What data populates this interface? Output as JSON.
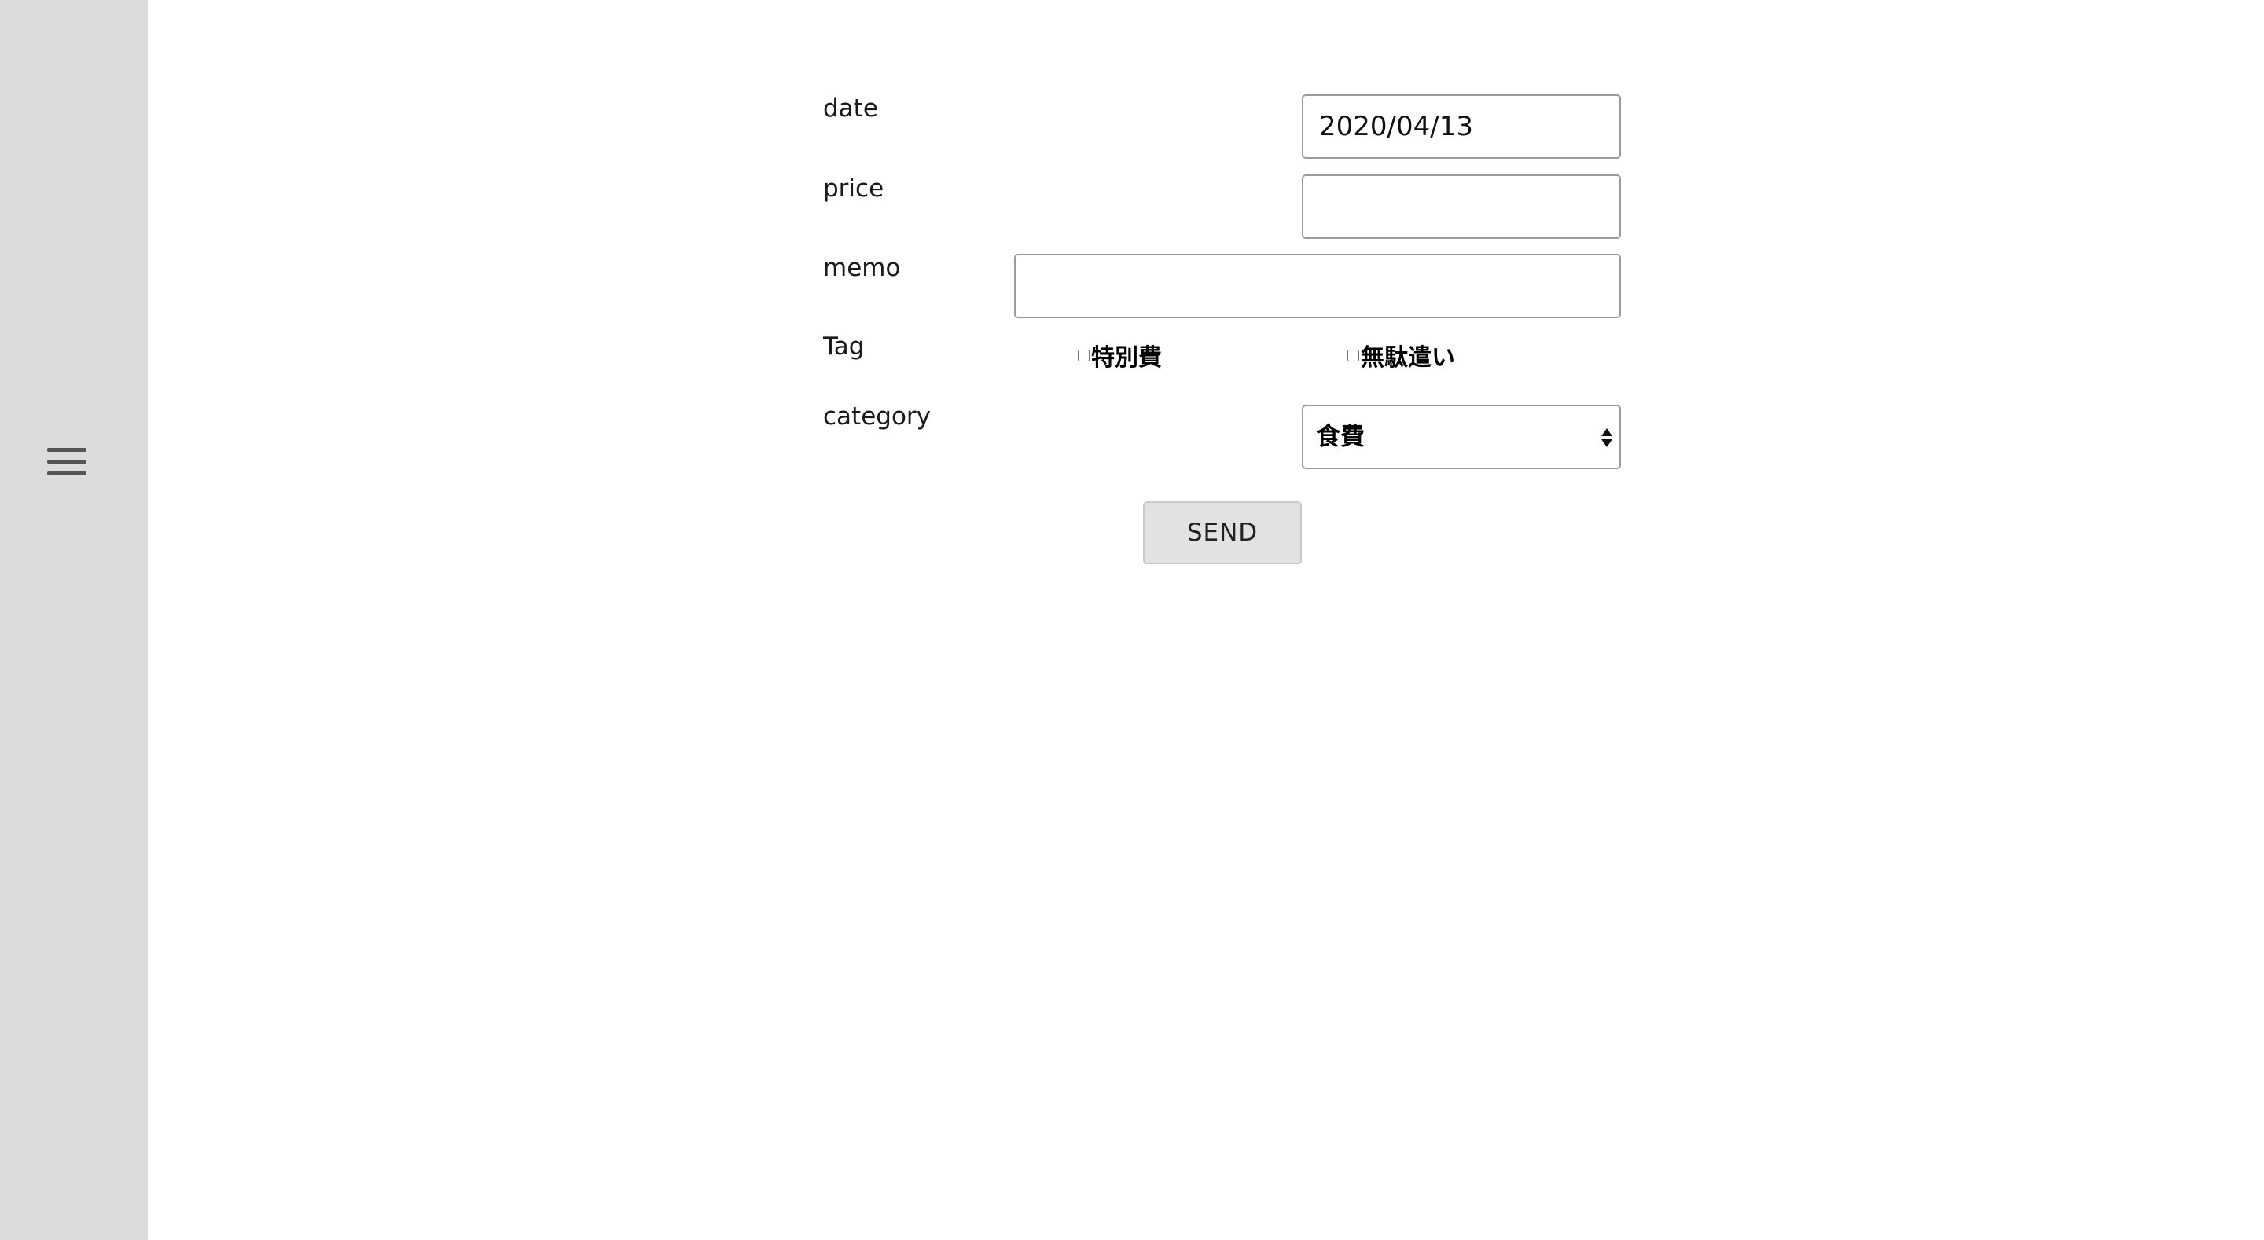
{
  "sidebar": {
    "menu_icon": "hamburger-menu-icon"
  },
  "form": {
    "date": {
      "label": "date",
      "value": "2020/04/13"
    },
    "price": {
      "label": "price",
      "value": ""
    },
    "memo": {
      "label": "memo",
      "value": ""
    },
    "tag": {
      "label": "Tag",
      "options": [
        {
          "label": "特別費",
          "checked": false
        },
        {
          "label": "無駄遣い",
          "checked": false
        }
      ]
    },
    "category": {
      "label": "category",
      "selected": "食費"
    },
    "send_label": "SEND"
  },
  "colors": {
    "sidebar_bg": "#dcdcdc",
    "menu_icon": "#555555",
    "input_border": "#9a9a9a",
    "button_bg": "#e2e2e2"
  }
}
